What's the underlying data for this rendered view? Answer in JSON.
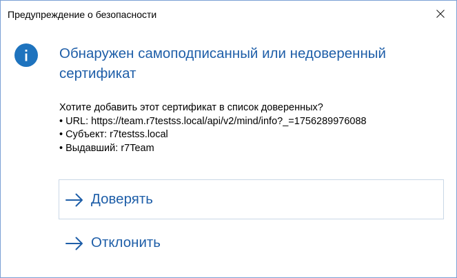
{
  "window": {
    "title": "Предупреждение о безопасности"
  },
  "message": {
    "heading": "Обнаружен самоподписанный или недоверенный сертификат",
    "question": "Хотите добавить этот сертификат в список доверенных?",
    "url_line": "• URL: https://team.r7testss.local/api/v2/mind/info?_=1756289976088",
    "subject_line": "• Субъект: r7testss.local",
    "issuer_line": "• Выдавший: r7Team"
  },
  "actions": {
    "trust_label": "Доверять",
    "reject_label": "Отклонить"
  },
  "icons": {
    "info": "info-icon",
    "close": "close-icon",
    "arrow": "arrow-right-icon"
  },
  "colors": {
    "accent": "#1e5ea8",
    "info_icon": "#1e73be",
    "window_border": "#7a9fd4",
    "button_border": "#c9d7e6"
  }
}
